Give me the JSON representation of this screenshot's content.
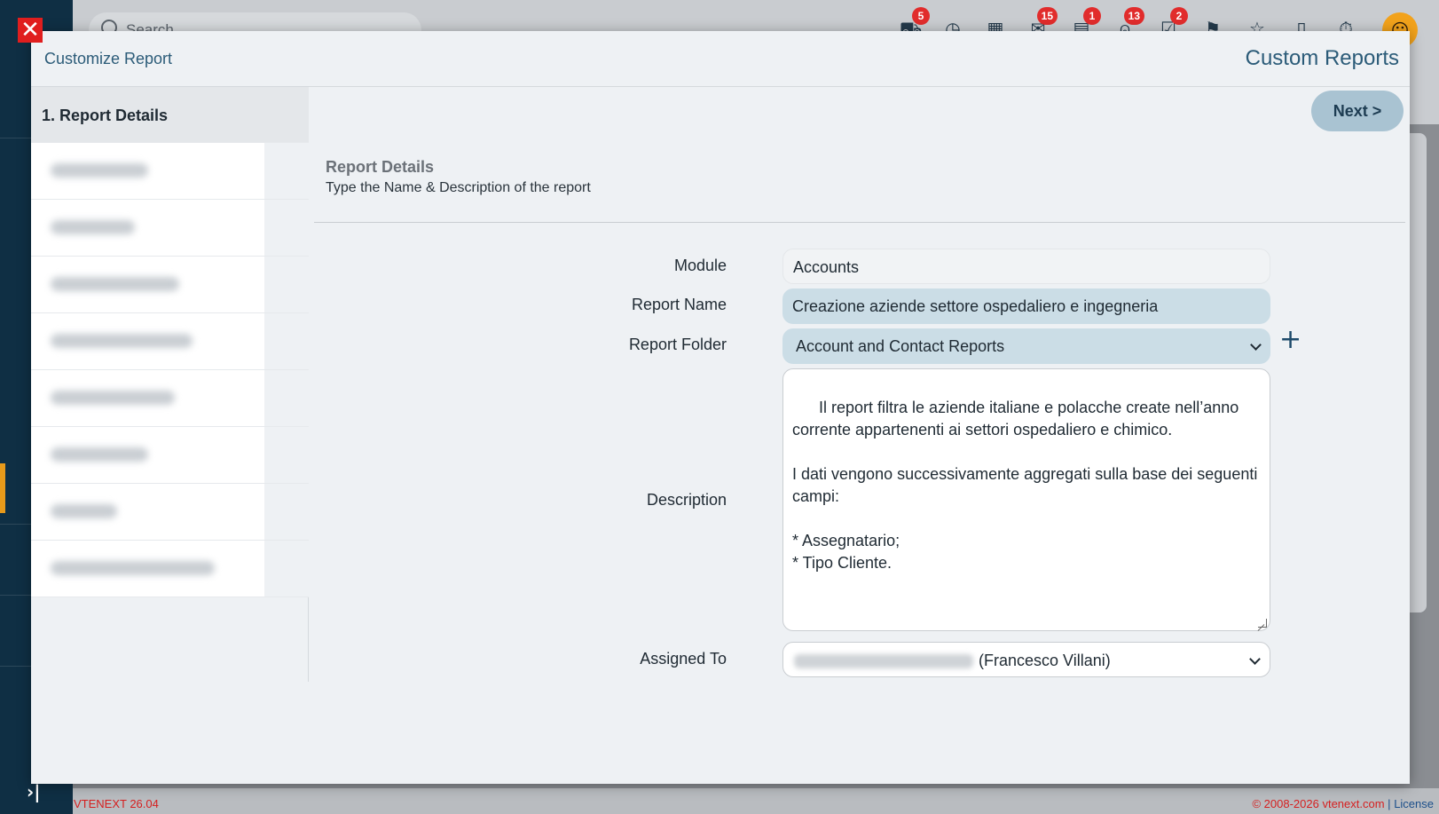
{
  "background": {
    "search_placeholder": "Search",
    "top_icons": [
      {
        "name": "processes-icon",
        "glyph": "⛟",
        "badge": "5"
      },
      {
        "name": "history-icon",
        "glyph": "◷",
        "badge": ""
      },
      {
        "name": "calendar-icon",
        "glyph": "▦",
        "badge": ""
      },
      {
        "name": "mail-icon",
        "glyph": "✉",
        "badge": "15"
      },
      {
        "name": "messages-icon",
        "glyph": "▤",
        "badge": "1"
      },
      {
        "name": "notifications-icon",
        "glyph": "⍝",
        "badge": "13"
      },
      {
        "name": "tasks-icon",
        "glyph": "☑",
        "badge": "2"
      },
      {
        "name": "flag-icon",
        "glyph": "⚑",
        "badge": ""
      },
      {
        "name": "favorites-icon",
        "glyph": "☆",
        "badge": ""
      },
      {
        "name": "document-icon",
        "glyph": "▯",
        "badge": ""
      },
      {
        "name": "timer-icon",
        "glyph": "⏱",
        "badge": ""
      }
    ],
    "footer_version": "VTENEXT 26.04",
    "footer_copyright": "© 2008-2026 vtenext.com",
    "footer_separator": "|",
    "footer_license": "License"
  },
  "modal": {
    "close_glyph": "✕",
    "title_left": "Customize Report",
    "title_right": "Custom Reports",
    "next_label": "Next >",
    "steps": [
      {
        "label": "1. Report Details",
        "active": true
      }
    ],
    "blurred_step_count": 8,
    "section_title": "Report Details",
    "section_subtitle": "Type the Name & Description of the report",
    "form": {
      "module_label": "Module",
      "module_value": "Accounts",
      "name_label": "Report Name",
      "name_value": "Creazione aziende settore ospedaliero e ingegneria",
      "folder_label": "Report Folder",
      "folder_value": "Account and Contact Reports",
      "description_label": "Description",
      "description_value": "Il report filtra le aziende italiane e polacche create nell’anno corrente appartenenti ai settori ospedaliero e chimico.\n\nI dati vengono successivamente aggregati sulla base dei seguenti campi:\n\n* Assegnatario;\n* Tipo Cliente.",
      "assigned_label": "Assigned To",
      "assigned_value": "(Francesco Villani)",
      "add_folder_glyph": "+"
    }
  }
}
